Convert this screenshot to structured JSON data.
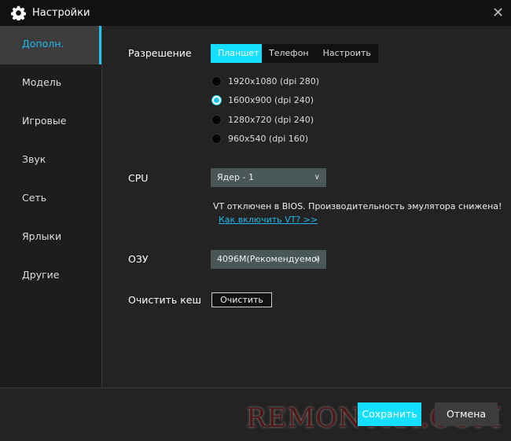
{
  "window": {
    "title": "Настройки",
    "icon": "gear-icon",
    "close": "✕"
  },
  "sidebar": {
    "items": [
      {
        "label": "Дополн.",
        "active": true
      },
      {
        "label": "Модель"
      },
      {
        "label": "Игровые"
      },
      {
        "label": "Звук"
      },
      {
        "label": "Сеть"
      },
      {
        "label": "Ярлыки"
      },
      {
        "label": "Другие"
      }
    ]
  },
  "resolution": {
    "label": "Разрешение",
    "tabs": [
      {
        "label": "Планшет",
        "active": true
      },
      {
        "label": "Телефон"
      },
      {
        "label": "Настроить"
      }
    ],
    "options": [
      {
        "label": "1920x1080  (dpi 280)"
      },
      {
        "label": "1600x900  (dpi 240)",
        "selected": true
      },
      {
        "label": "1280x720  (dpi 240)"
      },
      {
        "label": "960x540  (dpi 160)"
      }
    ]
  },
  "cpu": {
    "label": "CPU",
    "value": "Ядер - 1",
    "warning": "VT отключен в BIOS. Производительность эмулятора снижена!",
    "link": "Как включить VT? >>"
  },
  "ram": {
    "label": "ОЗУ",
    "value": "4096M(Рекомендуемо)"
  },
  "cache": {
    "label": "Очистить кеш",
    "button": "Очистить"
  },
  "footer": {
    "save": "Сохранить",
    "cancel": "Отмена"
  },
  "watermark": "REMONTKA.COM",
  "colors": {
    "accent": "#14dfff",
    "link": "#22b8ec",
    "select_bg": "#4a5757"
  }
}
